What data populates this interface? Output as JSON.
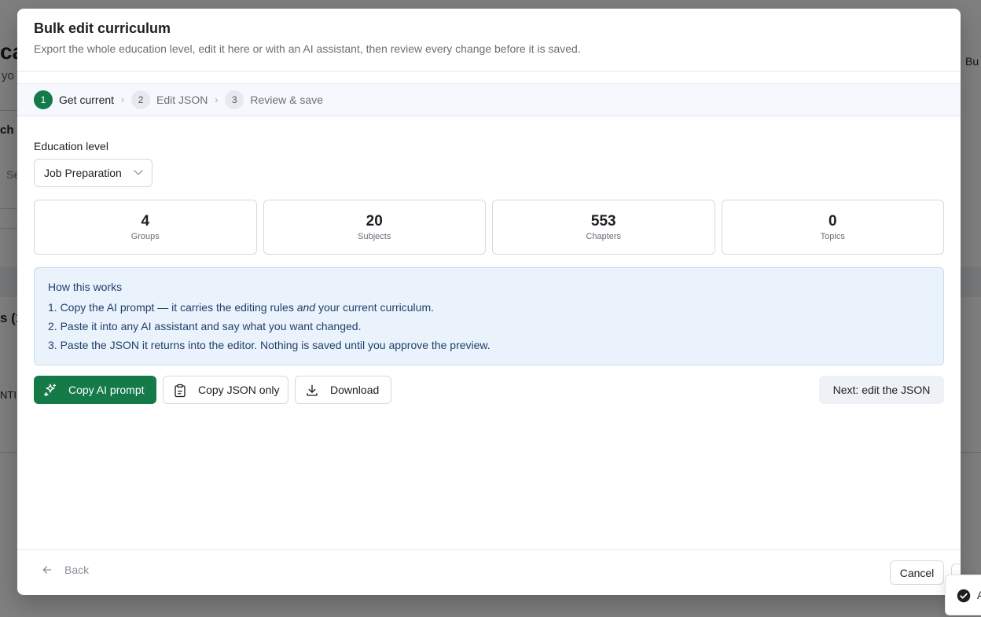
{
  "background": {
    "fragments": [
      "ca",
      "yo",
      "ch d",
      "Se",
      "s (1",
      "NTI",
      "Bu"
    ]
  },
  "dialog": {
    "title": "Bulk edit curriculum",
    "description": "Export the whole education level, edit it here or with an AI assistant, then review every change before it is saved."
  },
  "steps": [
    {
      "number": "1",
      "label": "Get current",
      "active": true
    },
    {
      "number": "2",
      "label": "Edit JSON",
      "active": false
    },
    {
      "number": "3",
      "label": "Review & save",
      "active": false
    }
  ],
  "education_level": {
    "label": "Education level",
    "selected": "Job Preparation"
  },
  "stats": [
    {
      "value": "4",
      "label": "Groups"
    },
    {
      "value": "20",
      "label": "Subjects"
    },
    {
      "value": "553",
      "label": "Chapters"
    },
    {
      "value": "0",
      "label": "Topics"
    }
  ],
  "info": {
    "title": "How this works",
    "line1_pre": "1. Copy the AI prompt — it carries the editing rules ",
    "line1_em": "and",
    "line1_post": " your current curriculum.",
    "line2": "2. Paste it into any AI assistant and say what you want changed.",
    "line3": "3. Paste the JSON it returns into the editor. Nothing is saved until you approve the preview."
  },
  "actions": {
    "copy_prompt": "Copy AI prompt",
    "copy_json": "Copy JSON only",
    "download": "Download",
    "next": "Next: edit the JSON"
  },
  "footer": {
    "back": "Back",
    "cancel": "Cancel"
  },
  "toast": {
    "text": "A"
  },
  "colors": {
    "primary": "#137a48",
    "info_bg": "#eaf2fc",
    "info_text": "#22406b"
  }
}
